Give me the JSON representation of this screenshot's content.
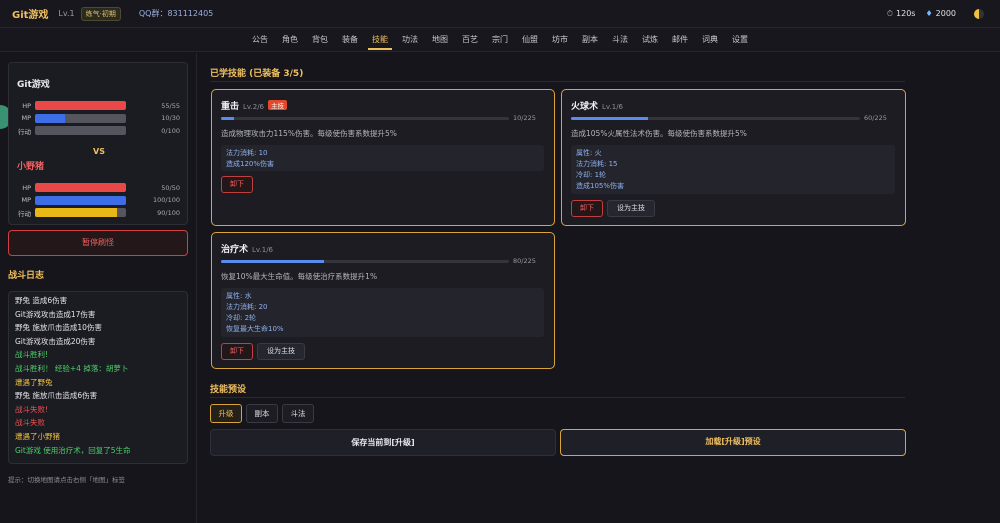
{
  "header": {
    "brand": "Git游戏",
    "level": "Lv.1",
    "stage": "练气·初期",
    "qq": "QQ群：831112405",
    "timer": "120s",
    "diamonds": "2000"
  },
  "nav": {
    "tabs": [
      "公告",
      "角色",
      "背包",
      "装备",
      "技能",
      "功法",
      "地图",
      "百艺",
      "宗门",
      "仙盟",
      "坊市",
      "副本",
      "斗法",
      "试炼",
      "邮件",
      "词典",
      "设置"
    ],
    "active": "技能"
  },
  "battle": {
    "player": {
      "name": "Git游戏",
      "stats": [
        {
          "label": "HP",
          "value": "55/55",
          "fill": 1.0,
          "kind": "hp"
        },
        {
          "label": "MP",
          "value": "10/30",
          "fill": 0.333,
          "kind": "mp"
        },
        {
          "label": "行动",
          "value": "0/100",
          "fill": 0.0,
          "kind": "act"
        }
      ]
    },
    "vs": "VS",
    "enemy": {
      "name": "小野猪",
      "stats": [
        {
          "label": "HP",
          "value": "50/50",
          "fill": 1.0,
          "kind": "hp"
        },
        {
          "label": "MP",
          "value": "100/100",
          "fill": 1.0,
          "kind": "mp"
        },
        {
          "label": "行动",
          "value": "90/100",
          "fill": 0.9,
          "kind": "act"
        }
      ]
    },
    "pause_label": "暂停刷怪"
  },
  "log": {
    "title": "战斗日志",
    "lines": [
      {
        "text": "野兔 造成6伤害",
        "color": "white"
      },
      {
        "text": "Git游戏攻击造成17伤害",
        "color": "white"
      },
      {
        "text": "野兔 施放爪击造成10伤害",
        "color": "white"
      },
      {
        "text": "Git游戏攻击造成20伤害",
        "color": "white"
      },
      {
        "text": "战斗胜利!",
        "color": "green"
      },
      {
        "text": "战斗胜利！ 经验+4 掉落：胡萝卜",
        "color": "green"
      },
      {
        "text": "遭遇了野兔",
        "color": "yellow"
      },
      {
        "text": "野兔 施放爪击造成6伤害",
        "color": "white"
      },
      {
        "text": "战斗失败!",
        "color": "red"
      },
      {
        "text": "战斗失败",
        "color": "red"
      },
      {
        "text": "遭遇了小野猪",
        "color": "yellow"
      },
      {
        "text": "Git游戏 使用治疗术，回复了5生命",
        "color": "green"
      }
    ],
    "hint": "提示：切换地图请点击右侧「地图」标签"
  },
  "skills": {
    "title": "已学技能 (已装备 3/5)",
    "cards": [
      {
        "name": "重击",
        "level": "Lv.2/6",
        "badge": "主技",
        "exp": "10/225",
        "exp_fill": 0.044,
        "desc": "造成物理攻击力115%伤害。每级使伤害系数提升5%",
        "info": [
          "法力消耗: 10",
          "造成120%伤害"
        ],
        "unequip": "卸下",
        "set_main": null
      },
      {
        "name": "火球术",
        "level": "Lv.1/6",
        "badge": null,
        "exp": "60/225",
        "exp_fill": 0.267,
        "desc": "造成105%火属性法术伤害。每级使伤害系数提升5%",
        "info": [
          "属性: 火",
          "法力消耗: 15",
          "冷却: 1轮",
          "造成105%伤害"
        ],
        "unequip": "卸下",
        "set_main": "设为主技"
      },
      {
        "name": "治疗术",
        "level": "Lv.1/6",
        "badge": null,
        "exp": "80/225",
        "exp_fill": 0.356,
        "desc": "恢复10%最大生命值。每级使治疗系数提升1%",
        "info": [
          "属性: 水",
          "法力消耗: 20",
          "冷却: 2轮",
          "恢复最大生命10%"
        ],
        "unequip": "卸下",
        "set_main": "设为主技"
      }
    ]
  },
  "presets": {
    "title": "技能预设",
    "tabs": [
      "升级",
      "副本",
      "斗法"
    ],
    "active": "升级",
    "save_label": "保存当前到[升级]",
    "load_label": "加载[升级]预设"
  }
}
